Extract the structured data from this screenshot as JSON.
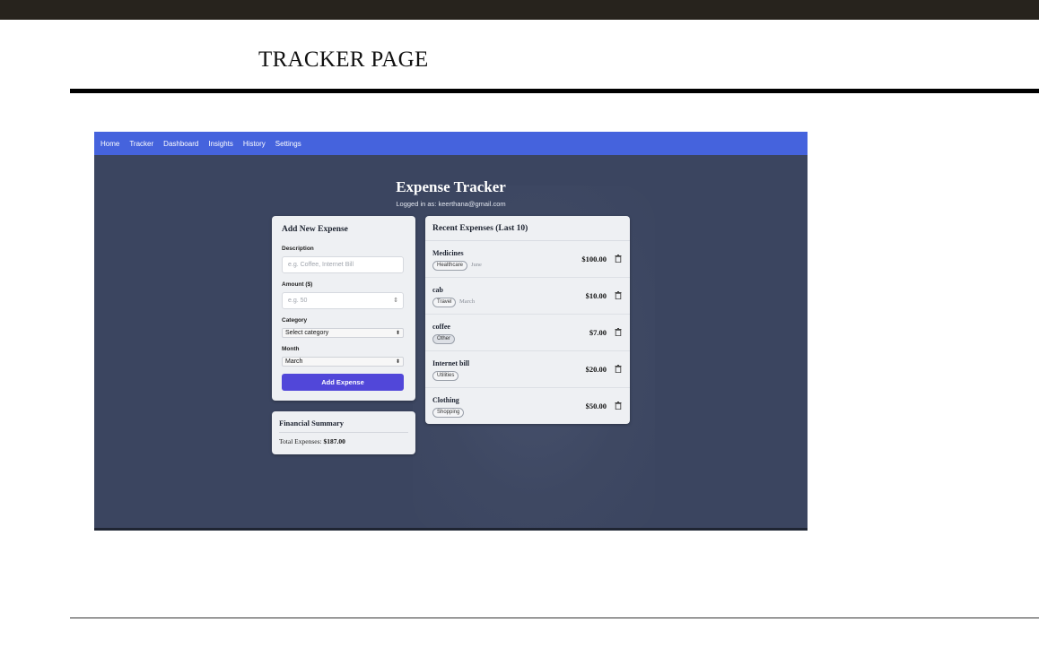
{
  "page": {
    "heading": "TRACKER PAGE"
  },
  "nav": {
    "items": [
      "Home",
      "Tracker",
      "Dashboard",
      "Insights",
      "History",
      "Settings"
    ]
  },
  "app": {
    "title": "Expense Tracker",
    "logged_in": "Logged in as: keerthana@gmail.com"
  },
  "add_expense": {
    "title": "Add New Expense",
    "description_label": "Description",
    "description_placeholder": "e.g. Coffee, Internet Bill",
    "amount_label": "Amount ($)",
    "amount_placeholder": "e.g. 50",
    "category_label": "Category",
    "category_value": "Select category",
    "month_label": "Month",
    "month_value": "March",
    "button_label": "Add Expense"
  },
  "summary": {
    "title": "Financial Summary",
    "total_label": "Total Expenses:",
    "total_value": "$187.00"
  },
  "recent": {
    "title": "Recent Expenses (Last 10)",
    "items": [
      {
        "name": "Medicines",
        "category": "Healthcare",
        "month": "June",
        "amount": "$100.00"
      },
      {
        "name": "cab",
        "category": "Travel",
        "month": "March",
        "amount": "$10.00"
      },
      {
        "name": "coffee",
        "category": "Other",
        "month": "",
        "amount": "$7.00"
      },
      {
        "name": "Internet bill",
        "category": "Utilities",
        "month": "",
        "amount": "$20.00"
      },
      {
        "name": "Clothing",
        "category": "Shopping",
        "month": "",
        "amount": "$50.00"
      }
    ]
  },
  "colors": {
    "navbar": "#4563dd",
    "button": "#5147d9",
    "background": "#3b4560"
  }
}
